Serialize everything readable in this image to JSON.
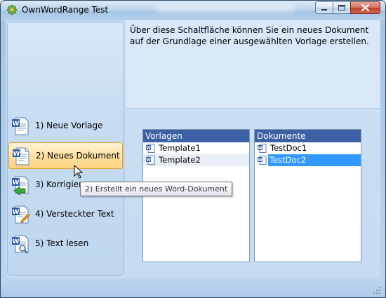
{
  "window": {
    "title": "OwnWordRange Test",
    "icon": "app-gear-icon"
  },
  "caption_buttons": {
    "minimize_icon": "minimize-icon",
    "maximize_icon": "maximize-icon",
    "close_icon": "close-icon"
  },
  "sidebar": {
    "items": [
      {
        "label": "1) Neue Vorlage",
        "icon": "word-document-icon"
      },
      {
        "label": "2) Neues Dokument",
        "icon": "new-document-icon",
        "selected": true
      },
      {
        "label": "3) Korrigieren",
        "icon": "correct-document-icon"
      },
      {
        "label": "4) Versteckter Text",
        "icon": "edit-document-icon"
      },
      {
        "label": "5) Text lesen",
        "icon": "read-document-icon"
      }
    ]
  },
  "tooltip": {
    "text": "2) Erstellt ein neues Word-Dokument"
  },
  "description": {
    "text": "Über diese Schaltfläche können Sie ein neues Dokument auf der Grundlage einer ausgewählten Vorlage erstellen."
  },
  "templates": {
    "header": "Vorlagen",
    "items": [
      "Template1",
      "Template2"
    ]
  },
  "documents": {
    "header": "Dokumente",
    "items": [
      "TestDoc1",
      "TestDoc2"
    ],
    "selected": "TestDoc2"
  },
  "colors": {
    "list_header": "#3e61a5",
    "selection": "#3399ff",
    "button_highlight": "#ffd27f"
  }
}
